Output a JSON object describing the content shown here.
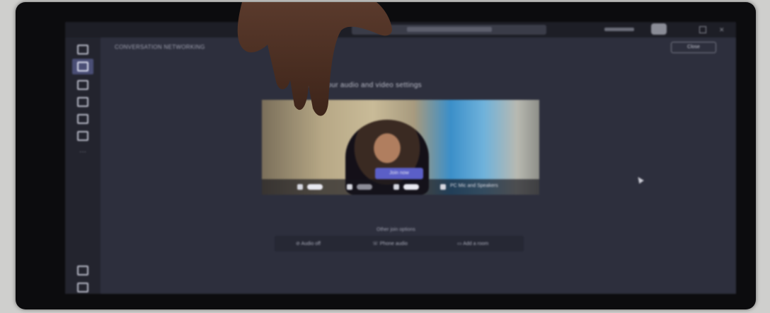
{
  "app": {
    "meeting_title": "CONVERSATION NETWORKING",
    "close_label": "Close",
    "colors": {
      "screen_bg": "#2d2f3d",
      "rail_bg": "#23242e",
      "accent": "#5b5fc7"
    }
  },
  "prejoin": {
    "prompt": "...oose your audio and video settings",
    "join_label": "Join now",
    "controls": [
      {
        "icon": "camera-icon",
        "state": "on"
      },
      {
        "icon": "background-blur-icon",
        "state": "off"
      },
      {
        "icon": "microphone-icon",
        "state": "on"
      },
      {
        "icon": "speaker-icon",
        "label": "PC Mic and Speakers"
      }
    ],
    "other_options_label": "Other join options",
    "options": [
      {
        "icon": "audio-off-icon",
        "label": "Audio off"
      },
      {
        "icon": "phone-icon",
        "label": "Phone audio"
      },
      {
        "icon": "add-room-icon",
        "label": "Add a room"
      }
    ]
  },
  "rail": {
    "icons": [
      "activity-icon",
      "chat-icon",
      "teams-icon",
      "calendar-icon",
      "calls-icon",
      "files-icon",
      "more-icon",
      "apps-icon",
      "help-icon"
    ]
  }
}
